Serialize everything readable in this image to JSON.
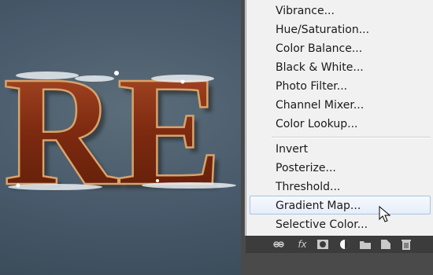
{
  "canvas": {
    "artwork_text": "RE",
    "colors": {
      "background": "#47596a",
      "letter_fill": "#8a3415",
      "letter_edge": "#d9a36a",
      "frost": "#e9eef2"
    }
  },
  "menu": {
    "items_top": [
      "Vibrance...",
      "Hue/Saturation...",
      "Color Balance...",
      "Black & White...",
      "Photo Filter...",
      "Channel Mixer...",
      "Color Lookup..."
    ],
    "items_bottom": [
      "Invert",
      "Posterize...",
      "Threshold...",
      "Gradient Map...",
      "Selective Color..."
    ],
    "highlighted": "Gradient Map...",
    "highlight_color": "#e6eef9"
  },
  "toolbar": {
    "icons": [
      "link-icon",
      "fx-icon",
      "mask-icon",
      "adjustment-icon",
      "folder-icon",
      "new-layer-icon",
      "trash-icon"
    ],
    "fx_label": "fx"
  }
}
